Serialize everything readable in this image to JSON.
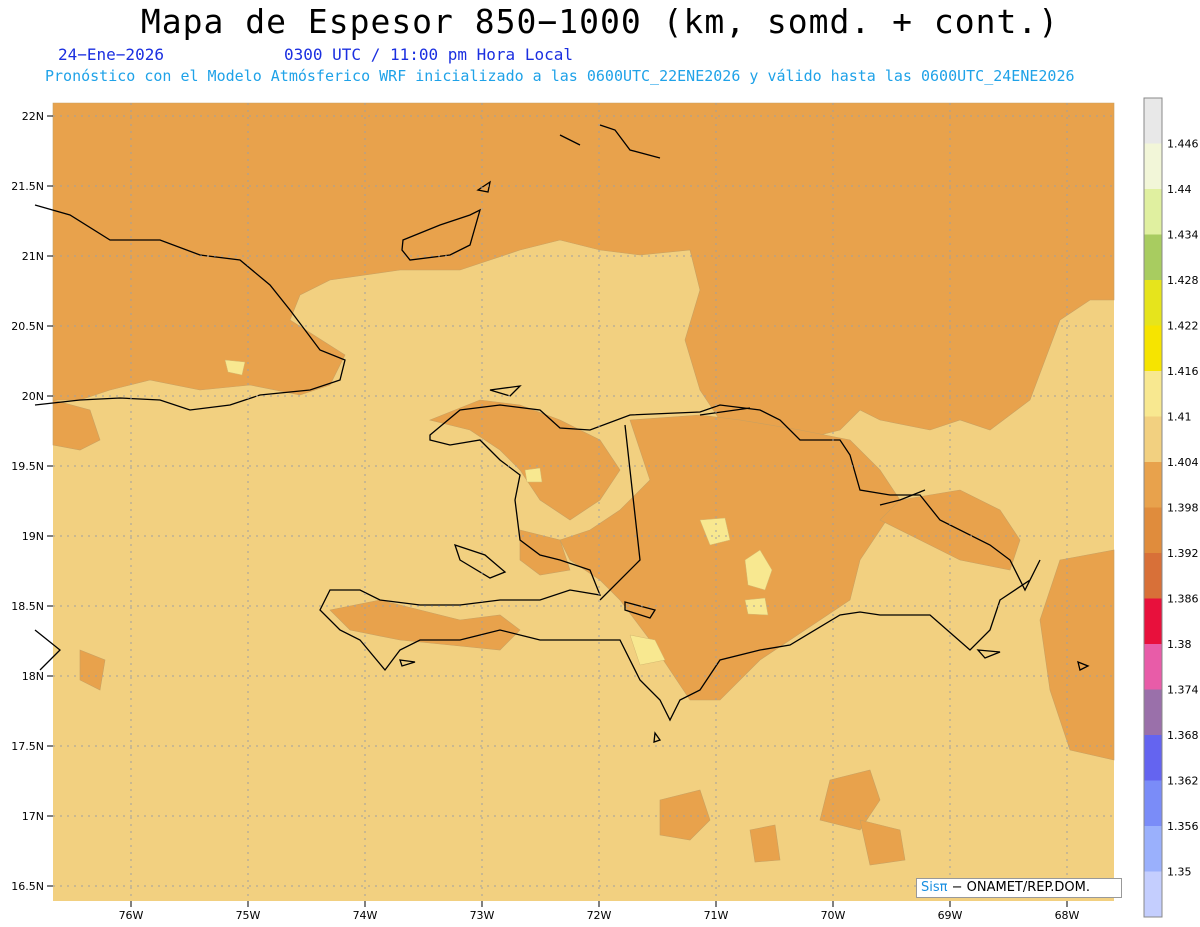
{
  "header": {
    "title": "Mapa de Espesor 850−1000 (km, somd. + cont.)",
    "date": "24−Ene−2026",
    "time": "0300 UTC / 11:00 pm Hora Local",
    "model_info": "Pronóstico con el Modelo Atmósferico WRF inicializado a las 0600UTC_22ENE2026 y válido hasta las  0600UTC_24ENE2026"
  },
  "axes": {
    "lat_labels": [
      "22N",
      "21.5N",
      "21N",
      "20.5N",
      "20N",
      "19.5N",
      "19N",
      "18.5N",
      "18N",
      "17.5N",
      "17N",
      "16.5N"
    ],
    "lon_labels": [
      "76W",
      "75W",
      "74W",
      "73W",
      "72W",
      "71W",
      "70W",
      "69W",
      "68W"
    ]
  },
  "colorbar": {
    "labels": [
      "1.446",
      "1.44",
      "1.434",
      "1.428",
      "1.422",
      "1.416",
      "1.41",
      "1.404",
      "1.398",
      "1.392",
      "1.386",
      "1.38",
      "1.374",
      "1.368",
      "1.362",
      "1.356",
      "1.35"
    ],
    "colors_top_to_bottom": [
      "#e8e8e8",
      "#f2f6d8",
      "#e0f0a0",
      "#a8cc60",
      "#e6e41c",
      "#f6e400",
      "#f8e890",
      "#f2d080",
      "#e8a24c",
      "#e08c3c",
      "#d87038",
      "#e8103c",
      "#e85ca8",
      "#9a70aa",
      "#6464f0",
      "#7a8cf8",
      "#9ab0fc",
      "#c4cefe"
    ]
  },
  "credit": {
    "logo": "Sisπ",
    "text": " − ONAMET/REP.DOM."
  },
  "colors": {
    "base": "#f2d080",
    "band_1398": "#e8a24c",
    "band_1410": "#f8e890",
    "coast": "#000000"
  }
}
